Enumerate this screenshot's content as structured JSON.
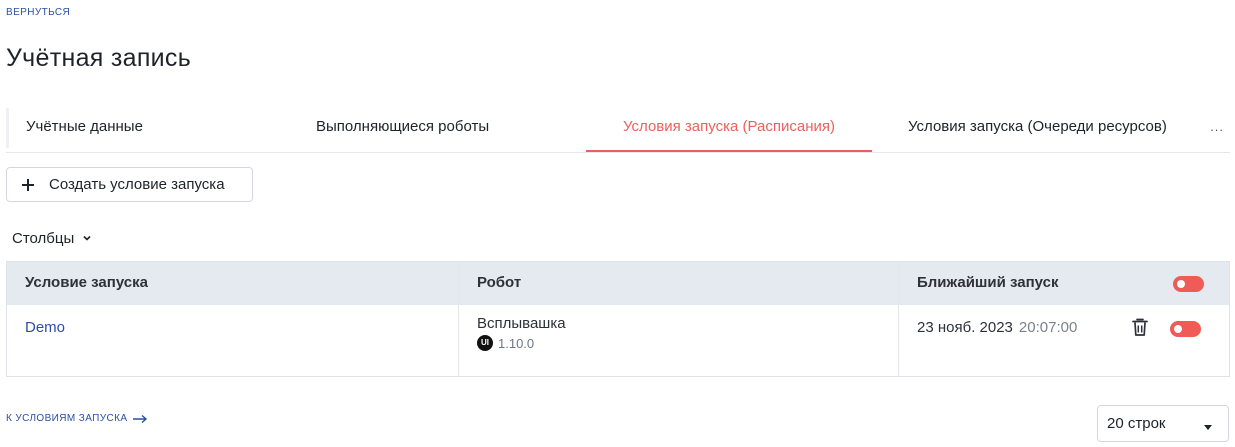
{
  "nav": {
    "back_label": "ВЕРНУТЬСЯ"
  },
  "page": {
    "title": "Учётная запись"
  },
  "tabs": [
    {
      "label": "Учётные данные"
    },
    {
      "label": "Выполняющиеся роботы"
    },
    {
      "label": "Условия запуска (Расписания)",
      "active": true
    },
    {
      "label": "Условия запуска (Очереди ресурсов)"
    }
  ],
  "tabs_more": "...",
  "toolbar": {
    "create_label": "Создать условие запуска",
    "columns_label": "Столбцы"
  },
  "table": {
    "headers": [
      "Условие запуска",
      "Робот",
      "Ближайший запуск"
    ],
    "header_toggle_on": true,
    "rows": [
      {
        "condition": "Demo",
        "robot_name": "Всплывашка",
        "robot_badge": "UI",
        "robot_version": "1.10.0",
        "next_date": "23 нояб. 2023",
        "next_time": "20:07:00",
        "enabled": true
      }
    ]
  },
  "footer": {
    "to_conditions_label": "К УСЛОВИЯМ ЗАПУСКА",
    "rows_per_page": "20 строк"
  },
  "colors": {
    "accent": "#e8625b",
    "link": "#2b4fa3",
    "header_bg": "#e5e9f0",
    "toggle": "#ef5b56"
  }
}
